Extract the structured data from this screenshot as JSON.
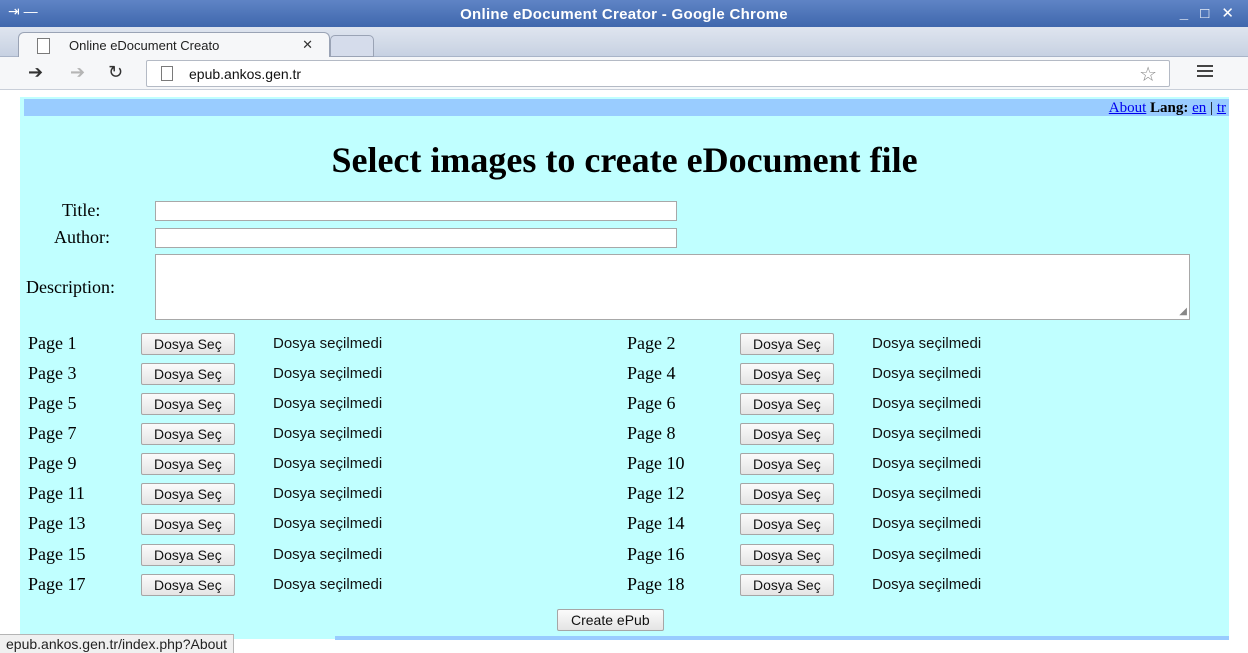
{
  "window": {
    "title": "Online eDocument Creator - Google Chrome",
    "left_controls": "⇥ —",
    "right_controls": "_ □ ✕"
  },
  "tab": {
    "label": "Online eDocument Creato",
    "close": "✕"
  },
  "toolbar": {
    "url": "epub.ankos.gen.tr"
  },
  "header": {
    "about": "About",
    "lang_label": "Lang:",
    "lang_en": "en",
    "separator": "|",
    "lang_tr": "tr"
  },
  "page_title": "Select images to create eDocument file",
  "form": {
    "title_label": "Title:",
    "title_value": "",
    "author_label": "Author:",
    "author_value": "",
    "description_label": "Description:",
    "description_value": ""
  },
  "pages": [
    {
      "label": "Page 1",
      "button": "Dosya Seç",
      "status": "Dosya seçilmedi"
    },
    {
      "label": "Page 2",
      "button": "Dosya Seç",
      "status": "Dosya seçilmedi"
    },
    {
      "label": "Page 3",
      "button": "Dosya Seç",
      "status": "Dosya seçilmedi"
    },
    {
      "label": "Page 4",
      "button": "Dosya Seç",
      "status": "Dosya seçilmedi"
    },
    {
      "label": "Page 5",
      "button": "Dosya Seç",
      "status": "Dosya seçilmedi"
    },
    {
      "label": "Page 6",
      "button": "Dosya Seç",
      "status": "Dosya seçilmedi"
    },
    {
      "label": "Page 7",
      "button": "Dosya Seç",
      "status": "Dosya seçilmedi"
    },
    {
      "label": "Page 8",
      "button": "Dosya Seç",
      "status": "Dosya seçilmedi"
    },
    {
      "label": "Page 9",
      "button": "Dosya Seç",
      "status": "Dosya seçilmedi"
    },
    {
      "label": "Page 10",
      "button": "Dosya Seç",
      "status": "Dosya seçilmedi"
    },
    {
      "label": "Page 11",
      "button": "Dosya Seç",
      "status": "Dosya seçilmedi"
    },
    {
      "label": "Page 12",
      "button": "Dosya Seç",
      "status": "Dosya seçilmedi"
    },
    {
      "label": "Page 13",
      "button": "Dosya Seç",
      "status": "Dosya seçilmedi"
    },
    {
      "label": "Page 14",
      "button": "Dosya Seç",
      "status": "Dosya seçilmedi"
    },
    {
      "label": "Page 15",
      "button": "Dosya Seç",
      "status": "Dosya seçilmedi"
    },
    {
      "label": "Page 16",
      "button": "Dosya Seç",
      "status": "Dosya seçilmedi"
    },
    {
      "label": "Page 17",
      "button": "Dosya Seç",
      "status": "Dosya seçilmedi"
    },
    {
      "label": "Page 18",
      "button": "Dosya Seç",
      "status": "Dosya seçilmedi"
    }
  ],
  "create_button": "Create ePub",
  "status_bar": "epub.ankos.gen.tr/index.php?About",
  "colors": {
    "titlebar": "#4a70b5",
    "content_bg": "#c0ffff",
    "band": "#99ccff",
    "link": "#0000ee"
  }
}
